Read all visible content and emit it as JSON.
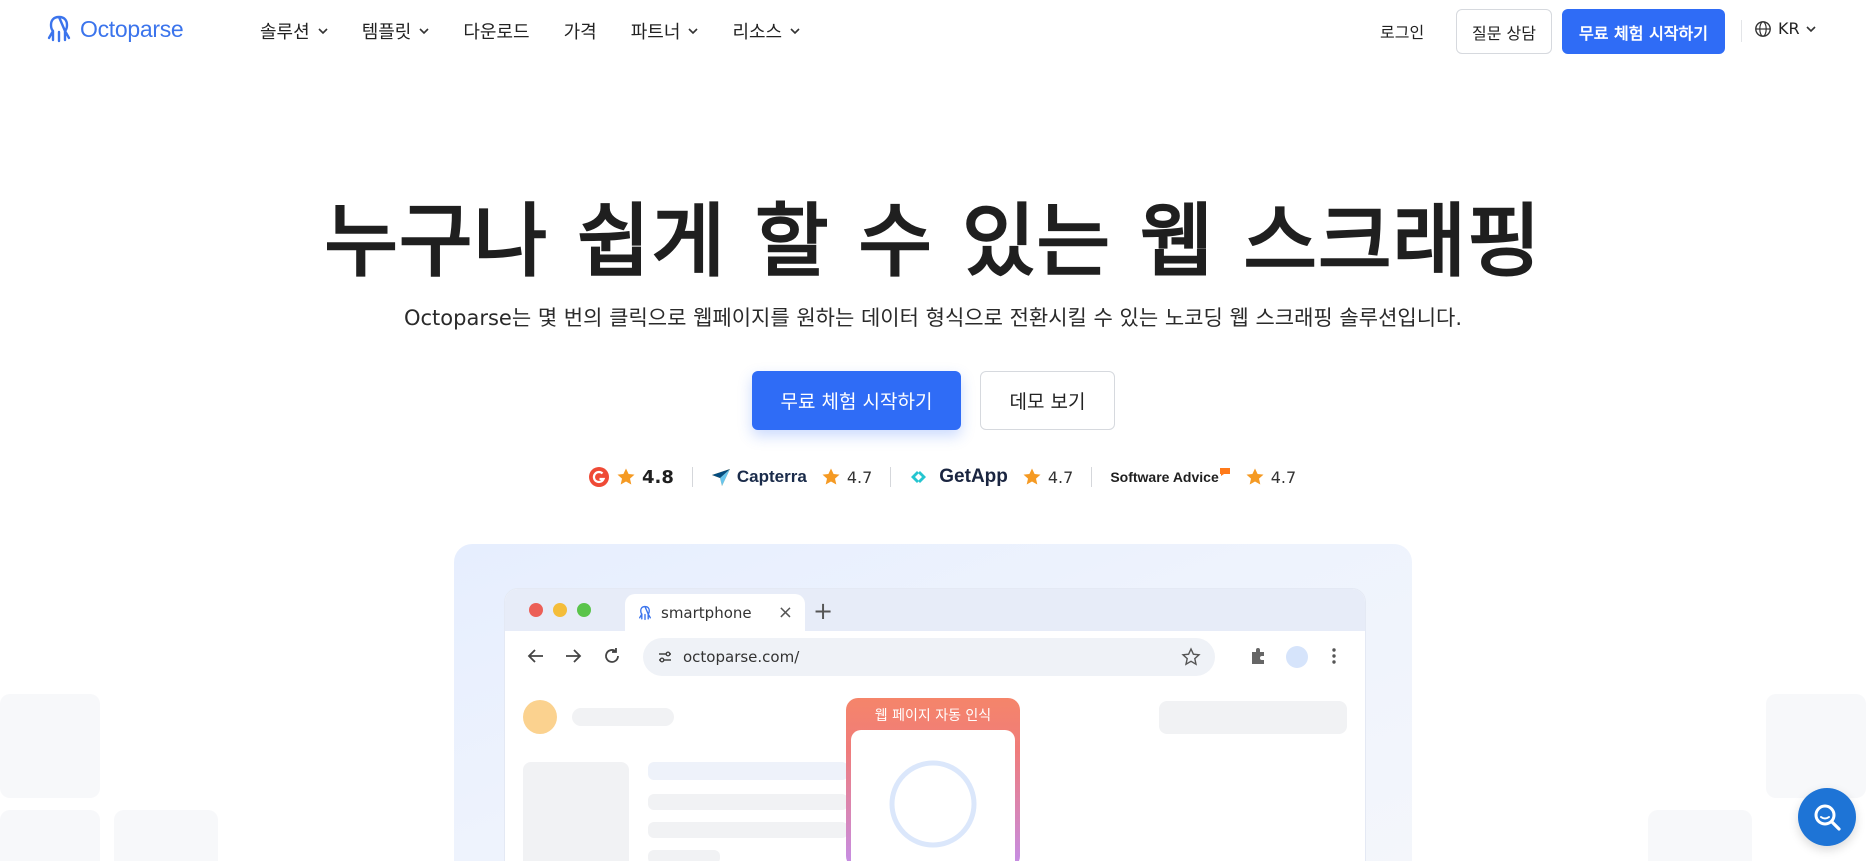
{
  "header": {
    "logo_text": "Octoparse",
    "nav": [
      {
        "label": "솔루션",
        "has_dropdown": true
      },
      {
        "label": "템플릿",
        "has_dropdown": true
      },
      {
        "label": "다운로드",
        "has_dropdown": false
      },
      {
        "label": "가격",
        "has_dropdown": false
      },
      {
        "label": "파트너",
        "has_dropdown": true
      },
      {
        "label": "리소스",
        "has_dropdown": true
      }
    ],
    "login_label": "로그인",
    "consult_label": "질문 상담",
    "trial_label": "무료 체험 시작하기",
    "language": "KR"
  },
  "hero": {
    "title": "누구나 쉽게 할 수 있는 웹 스크래핑",
    "subtitle": "Octoparse는 몇 번의 클릭으로 웹페이지를 원하는 데이터 형식으로 전환시킬 수 있는 노코딩 웹 스크래핑 솔루션입니다.",
    "primary_cta": "무료 체험 시작하기",
    "secondary_cta": "데모 보기"
  },
  "ratings": [
    {
      "brand": "G2",
      "score": "4.8"
    },
    {
      "brand": "Capterra",
      "score": "4.7"
    },
    {
      "brand": "GetApp",
      "score": "4.7"
    },
    {
      "brand": "Software Advice",
      "score": "4.7"
    }
  ],
  "browser_mock": {
    "tab_title": "smartphone",
    "url": "octoparse.com/",
    "card_label": "웹 페이지 자동 인식"
  },
  "colors": {
    "brand_blue": "#2f6cf6",
    "logo_blue": "#3b74ec",
    "star_orange": "#f59a23",
    "chat_blue": "#1e74d6"
  }
}
